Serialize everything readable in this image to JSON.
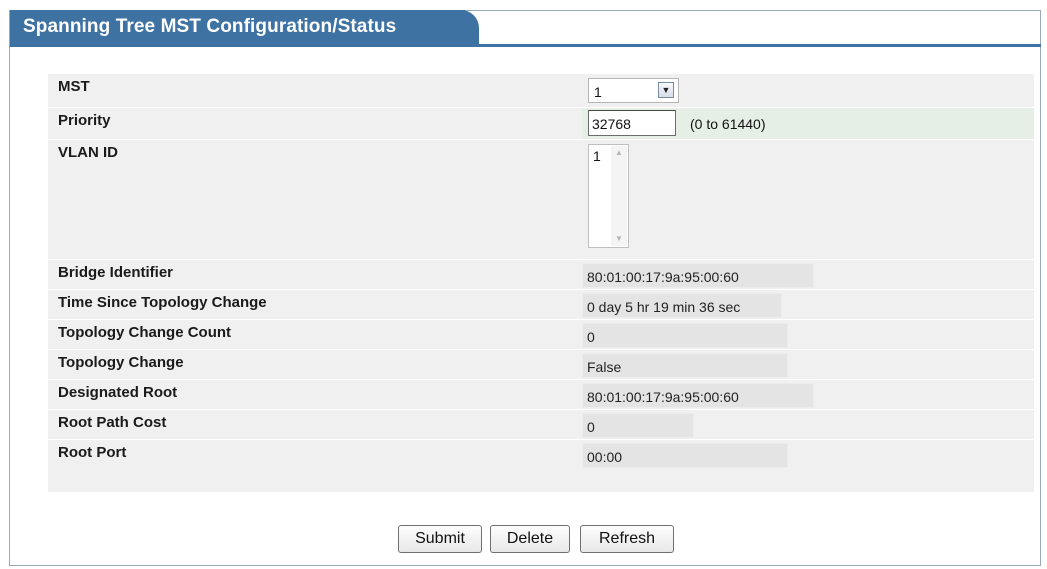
{
  "panel": {
    "title": "Spanning Tree MST Configuration/Status"
  },
  "fields": {
    "mst": {
      "label": "MST",
      "value": "1"
    },
    "priority": {
      "label": "Priority",
      "value": "32768",
      "hint": "(0 to 61440)"
    },
    "vlan_id": {
      "label": "VLAN ID",
      "items": [
        "1"
      ]
    },
    "bridge_identifier": {
      "label": "Bridge Identifier",
      "value": "80:01:00:17:9a:95:00:60"
    },
    "time_since_topology_change": {
      "label": "Time Since Topology Change",
      "value": "0 day 5 hr 19 min 36 sec"
    },
    "topology_change_count": {
      "label": "Topology Change Count",
      "value": "0"
    },
    "topology_change": {
      "label": "Topology Change",
      "value": "False"
    },
    "designated_root": {
      "label": "Designated Root",
      "value": "80:01:00:17:9a:95:00:60"
    },
    "root_path_cost": {
      "label": "Root Path Cost",
      "value": "0"
    },
    "root_port": {
      "label": "Root Port",
      "value": "00:00"
    }
  },
  "buttons": {
    "submit": "Submit",
    "delete": "Delete",
    "refresh": "Refresh"
  },
  "colors": {
    "title_bar": "#3e72a3",
    "row_background": "#f0f0f0",
    "value_background": "#e4e4e4"
  },
  "icons": {
    "dropdown": "chevron-down-icon",
    "scroll_up": "scroll-up-arrow-icon",
    "scroll_down": "scroll-down-arrow-icon"
  }
}
